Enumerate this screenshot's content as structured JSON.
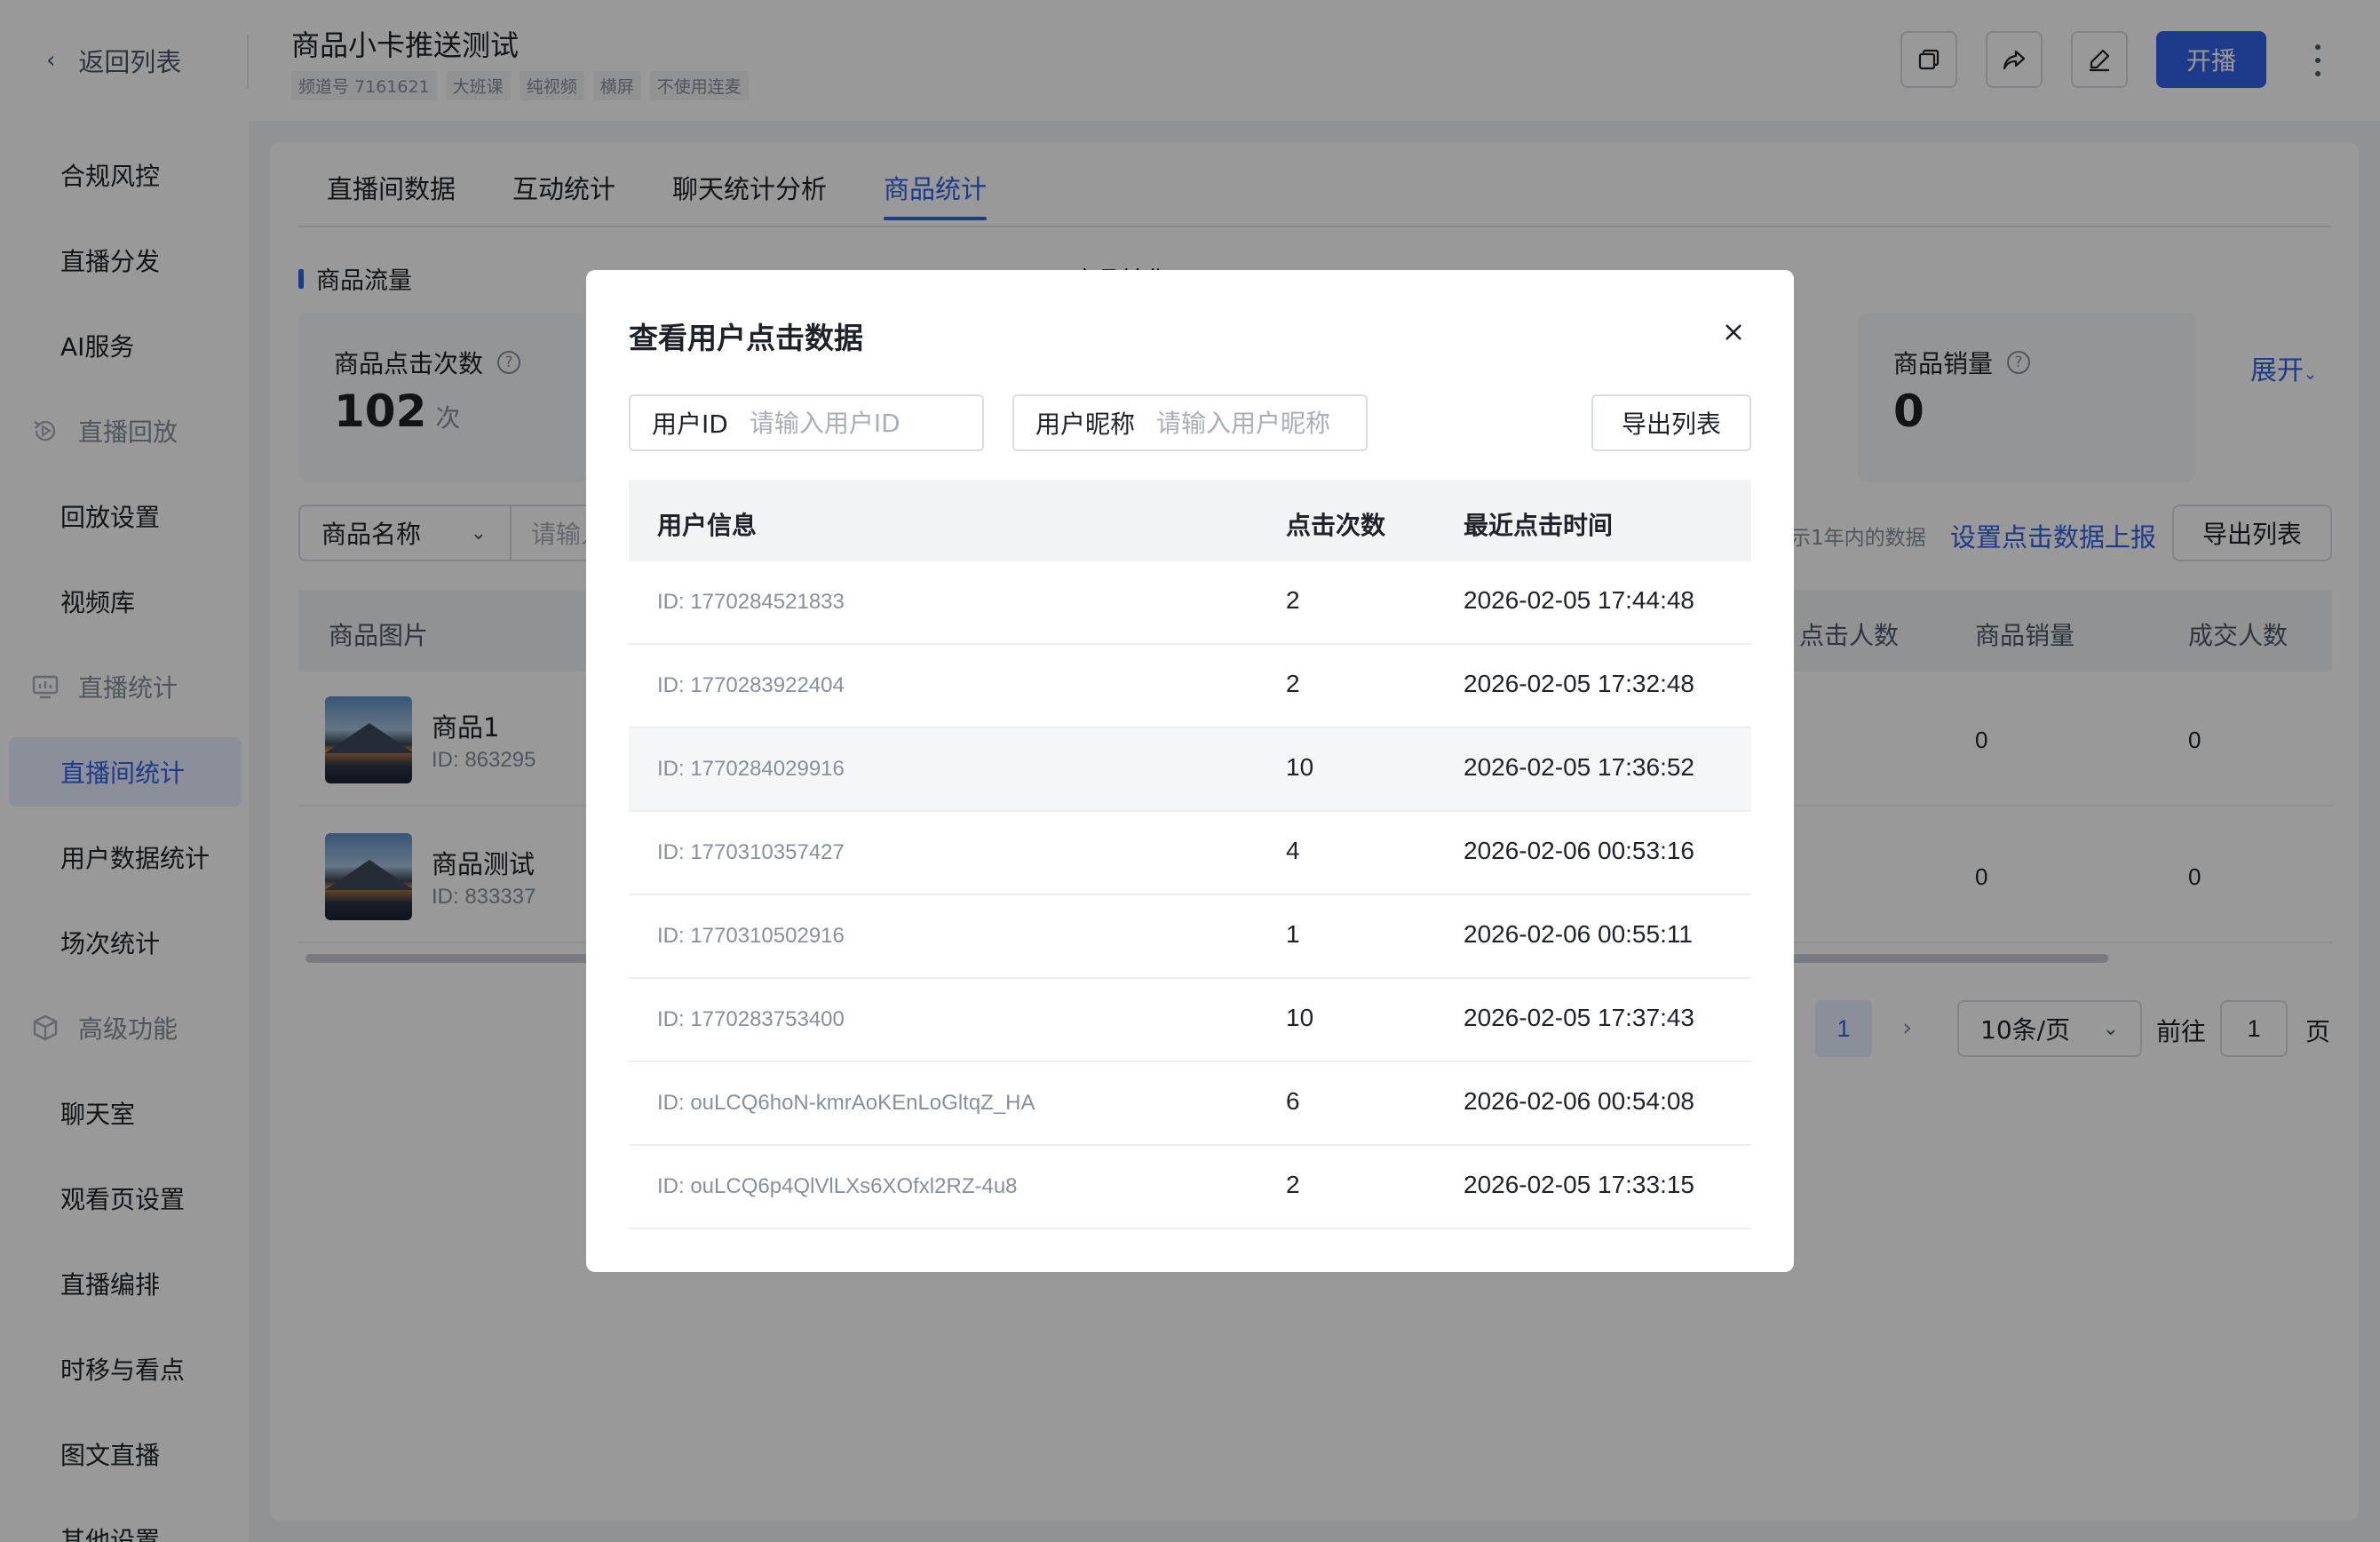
{
  "header": {
    "back_label": "返回列表",
    "title": "商品小卡推送测试",
    "tags": [
      "频道号 7161621",
      "大班课",
      "纯视频",
      "横屏",
      "不使用连麦"
    ],
    "start_label": "开播"
  },
  "sidebar": {
    "items": [
      {
        "label": "合规风控",
        "type": "item"
      },
      {
        "label": "直播分发",
        "type": "item"
      },
      {
        "label": "AI服务",
        "type": "item"
      },
      {
        "label": "直播回放",
        "type": "group",
        "icon": "replay-icon"
      },
      {
        "label": "回放设置",
        "type": "item"
      },
      {
        "label": "视频库",
        "type": "item"
      },
      {
        "label": "直播统计",
        "type": "group",
        "icon": "stats-icon"
      },
      {
        "label": "直播间统计",
        "type": "item",
        "active": true
      },
      {
        "label": "用户数据统计",
        "type": "item"
      },
      {
        "label": "场次统计",
        "type": "item"
      },
      {
        "label": "高级功能",
        "type": "group",
        "icon": "cube-icon"
      },
      {
        "label": "聊天室",
        "type": "item"
      },
      {
        "label": "观看页设置",
        "type": "item"
      },
      {
        "label": "直播编排",
        "type": "item"
      },
      {
        "label": "时移与看点",
        "type": "item"
      },
      {
        "label": "图文直播",
        "type": "item"
      },
      {
        "label": "其他设置",
        "type": "item"
      }
    ]
  },
  "main": {
    "tabs": [
      "直播间数据",
      "互动统计",
      "聊天统计分析",
      "商品统计"
    ],
    "active_tab": 3,
    "section_traffic": "商品流量",
    "section_conversion": "商品转化",
    "cards": {
      "clicks_label": "商品点击次数",
      "clicks_value": "102",
      "clicks_unit": "次",
      "sales_label": "商品销量",
      "sales_value": "0"
    },
    "expand_label": "展开",
    "filter_select": "商品名称",
    "filter_placeholder": "请输入",
    "data_note": "示1年内的数据",
    "set_report_link": "设置点击数据上报",
    "export_label": "导出列表",
    "table_headers": {
      "image": "商品图片",
      "click_users": "点击人数",
      "sales": "商品销量",
      "buyers": "成交人数"
    },
    "products": [
      {
        "name": "商品1",
        "id": "ID: 863295",
        "sales": "0",
        "buyers": "0"
      },
      {
        "name": "商品测试",
        "id": "ID: 833337",
        "sales": "0",
        "buyers": "0"
      }
    ],
    "pagination": {
      "current": "1",
      "next": "›",
      "page_size": "10条/页",
      "goto_label": "前往",
      "goto_value": "1",
      "page_suffix": "页"
    }
  },
  "modal": {
    "title": "查看用户点击数据",
    "user_id_label": "用户ID",
    "user_id_placeholder": "请输入用户ID",
    "nickname_label": "用户昵称",
    "nickname_placeholder": "请输入用户昵称",
    "export_label": "导出列表",
    "columns": {
      "user": "用户信息",
      "clicks": "点击次数",
      "last_time": "最近点击时间"
    },
    "rows": [
      {
        "user": "ID: 1770284521833",
        "clicks": "2",
        "time": "2026-02-05 17:44:48"
      },
      {
        "user": "ID: 1770283922404",
        "clicks": "2",
        "time": "2026-02-05 17:32:48"
      },
      {
        "user": "ID: 1770284029916",
        "clicks": "10",
        "time": "2026-02-05 17:36:52"
      },
      {
        "user": "ID: 1770310357427",
        "clicks": "4",
        "time": "2026-02-06 00:53:16"
      },
      {
        "user": "ID: 1770310502916",
        "clicks": "1",
        "time": "2026-02-06 00:55:11"
      },
      {
        "user": "ID: 1770283753400",
        "clicks": "10",
        "time": "2026-02-05 17:37:43"
      },
      {
        "user": "ID: ouLCQ6hoN-kmrAoKEnLoGltqZ_HA",
        "clicks": "6",
        "time": "2026-02-06 00:54:08"
      },
      {
        "user": "ID: ouLCQ6p4QlVlLXs6XOfxl2RZ-4u8",
        "clicks": "2",
        "time": "2026-02-05 17:33:15"
      }
    ]
  },
  "colors": {
    "primary": "#3361e8",
    "mask": "rgba(0,0,0,0.40)"
  }
}
